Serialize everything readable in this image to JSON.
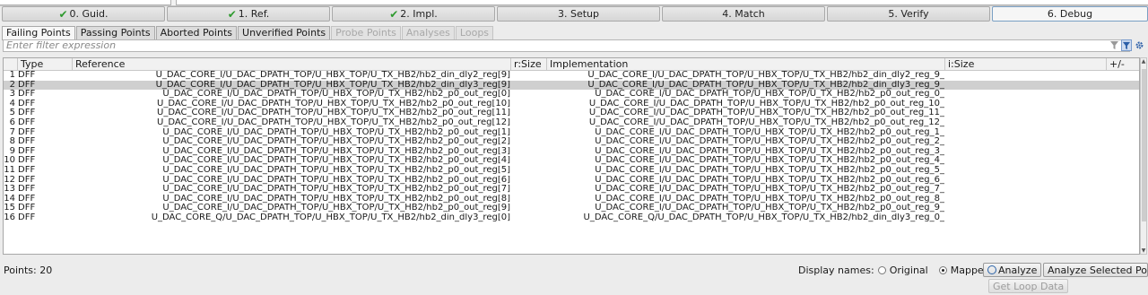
{
  "steps": [
    {
      "label": "0. Guid.",
      "done": true
    },
    {
      "label": "1. Ref.",
      "done": true
    },
    {
      "label": "2. Impl.",
      "done": true
    },
    {
      "label": "3. Setup",
      "done": false
    },
    {
      "label": "4. Match",
      "done": false
    },
    {
      "label": "5. Verify",
      "done": false
    },
    {
      "label": "6. Debug",
      "done": false
    }
  ],
  "subtabs": [
    "Failing Points",
    "Passing Points",
    "Aborted Points",
    "Unverified Points",
    "Probe Points",
    "Analyses",
    "Loops"
  ],
  "filter": {
    "placeholder": "Enter filter expression"
  },
  "table": {
    "headers": {
      "type": "Type",
      "reference": "Reference",
      "rsize": "r:Size",
      "implementation": "Implementation",
      "isize": "i:Size",
      "pm": "+/-"
    },
    "rows": [
      {
        "n": "1",
        "type": "DFF",
        "ref": "U_DAC_CORE_I/U_DAC_DPATH_TOP/U_HBX_TOP/U_TX_HB2/hb2_din_dly2_reg[9]",
        "impl": "U_DAC_CORE_I/U_DAC_DPATH_TOP/U_HBX_TOP/U_TX_HB2/hb2_din_dly2_reg_9_"
      },
      {
        "n": "2",
        "type": "DFF",
        "ref": "U_DAC_CORE_I/U_DAC_DPATH_TOP/U_HBX_TOP/U_TX_HB2/hb2_din_dly3_reg[9]",
        "impl": "U_DAC_CORE_I/U_DAC_DPATH_TOP/U_HBX_TOP/U_TX_HB2/hb2_din_dly3_reg_9_"
      },
      {
        "n": "3",
        "type": "DFF",
        "ref": "U_DAC_CORE_I/U_DAC_DPATH_TOP/U_HBX_TOP/U_TX_HB2/hb2_p0_out_reg[0]",
        "impl": "U_DAC_CORE_I/U_DAC_DPATH_TOP/U_HBX_TOP/U_TX_HB2/hb2_p0_out_reg_0_"
      },
      {
        "n": "4",
        "type": "DFF",
        "ref": "U_DAC_CORE_I/U_DAC_DPATH_TOP/U_HBX_TOP/U_TX_HB2/hb2_p0_out_reg[10]",
        "impl": "U_DAC_CORE_I/U_DAC_DPATH_TOP/U_HBX_TOP/U_TX_HB2/hb2_p0_out_reg_10_"
      },
      {
        "n": "5",
        "type": "DFF",
        "ref": "U_DAC_CORE_I/U_DAC_DPATH_TOP/U_HBX_TOP/U_TX_HB2/hb2_p0_out_reg[11]",
        "impl": "U_DAC_CORE_I/U_DAC_DPATH_TOP/U_HBX_TOP/U_TX_HB2/hb2_p0_out_reg_11_"
      },
      {
        "n": "6",
        "type": "DFF",
        "ref": "U_DAC_CORE_I/U_DAC_DPATH_TOP/U_HBX_TOP/U_TX_HB2/hb2_p0_out_reg[12]",
        "impl": "U_DAC_CORE_I/U_DAC_DPATH_TOP/U_HBX_TOP/U_TX_HB2/hb2_p0_out_reg_12_"
      },
      {
        "n": "7",
        "type": "DFF",
        "ref": "U_DAC_CORE_I/U_DAC_DPATH_TOP/U_HBX_TOP/U_TX_HB2/hb2_p0_out_reg[1]",
        "impl": "U_DAC_CORE_I/U_DAC_DPATH_TOP/U_HBX_TOP/U_TX_HB2/hb2_p0_out_reg_1_"
      },
      {
        "n": "8",
        "type": "DFF",
        "ref": "U_DAC_CORE_I/U_DAC_DPATH_TOP/U_HBX_TOP/U_TX_HB2/hb2_p0_out_reg[2]",
        "impl": "U_DAC_CORE_I/U_DAC_DPATH_TOP/U_HBX_TOP/U_TX_HB2/hb2_p0_out_reg_2_"
      },
      {
        "n": "9",
        "type": "DFF",
        "ref": "U_DAC_CORE_I/U_DAC_DPATH_TOP/U_HBX_TOP/U_TX_HB2/hb2_p0_out_reg[3]",
        "impl": "U_DAC_CORE_I/U_DAC_DPATH_TOP/U_HBX_TOP/U_TX_HB2/hb2_p0_out_reg_3_"
      },
      {
        "n": "10",
        "type": "DFF",
        "ref": "U_DAC_CORE_I/U_DAC_DPATH_TOP/U_HBX_TOP/U_TX_HB2/hb2_p0_out_reg[4]",
        "impl": "U_DAC_CORE_I/U_DAC_DPATH_TOP/U_HBX_TOP/U_TX_HB2/hb2_p0_out_reg_4_"
      },
      {
        "n": "11",
        "type": "DFF",
        "ref": "U_DAC_CORE_I/U_DAC_DPATH_TOP/U_HBX_TOP/U_TX_HB2/hb2_p0_out_reg[5]",
        "impl": "U_DAC_CORE_I/U_DAC_DPATH_TOP/U_HBX_TOP/U_TX_HB2/hb2_p0_out_reg_5_"
      },
      {
        "n": "12",
        "type": "DFF",
        "ref": "U_DAC_CORE_I/U_DAC_DPATH_TOP/U_HBX_TOP/U_TX_HB2/hb2_p0_out_reg[6]",
        "impl": "U_DAC_CORE_I/U_DAC_DPATH_TOP/U_HBX_TOP/U_TX_HB2/hb2_p0_out_reg_6_"
      },
      {
        "n": "13",
        "type": "DFF",
        "ref": "U_DAC_CORE_I/U_DAC_DPATH_TOP/U_HBX_TOP/U_TX_HB2/hb2_p0_out_reg[7]",
        "impl": "U_DAC_CORE_I/U_DAC_DPATH_TOP/U_HBX_TOP/U_TX_HB2/hb2_p0_out_reg_7_"
      },
      {
        "n": "14",
        "type": "DFF",
        "ref": "U_DAC_CORE_I/U_DAC_DPATH_TOP/U_HBX_TOP/U_TX_HB2/hb2_p0_out_reg[8]",
        "impl": "U_DAC_CORE_I/U_DAC_DPATH_TOP/U_HBX_TOP/U_TX_HB2/hb2_p0_out_reg_8_"
      },
      {
        "n": "15",
        "type": "DFF",
        "ref": "U_DAC_CORE_I/U_DAC_DPATH_TOP/U_HBX_TOP/U_TX_HB2/hb2_p0_out_reg[9]",
        "impl": "U_DAC_CORE_I/U_DAC_DPATH_TOP/U_HBX_TOP/U_TX_HB2/hb2_p0_out_reg_9_"
      },
      {
        "n": "16",
        "type": "DFF",
        "ref": "U_DAC_CORE_Q/U_DAC_DPATH_TOP/U_HBX_TOP/U_TX_HB2/hb2_din_dly3_reg[0]",
        "impl": "U_DAC_CORE_Q/U_DAC_DPATH_TOP/U_HBX_TOP/U_TX_HB2/hb2_din_dly3_reg_0_"
      }
    ],
    "selected_row": "2"
  },
  "status": {
    "points": "Points: 20"
  },
  "display_names": {
    "label": "Display names:",
    "original": "Original",
    "mapped": "Mapped",
    "selected": "Mapped"
  },
  "buttons": {
    "analyze": "Analyze",
    "analyze_selected": "Analyze Selected Points",
    "get_loop_data": "Get Loop Data"
  },
  "icons": {
    "filter_clear": "funnel-clear-icon",
    "filter_apply": "funnel-icon",
    "settings": "gear-icon"
  }
}
